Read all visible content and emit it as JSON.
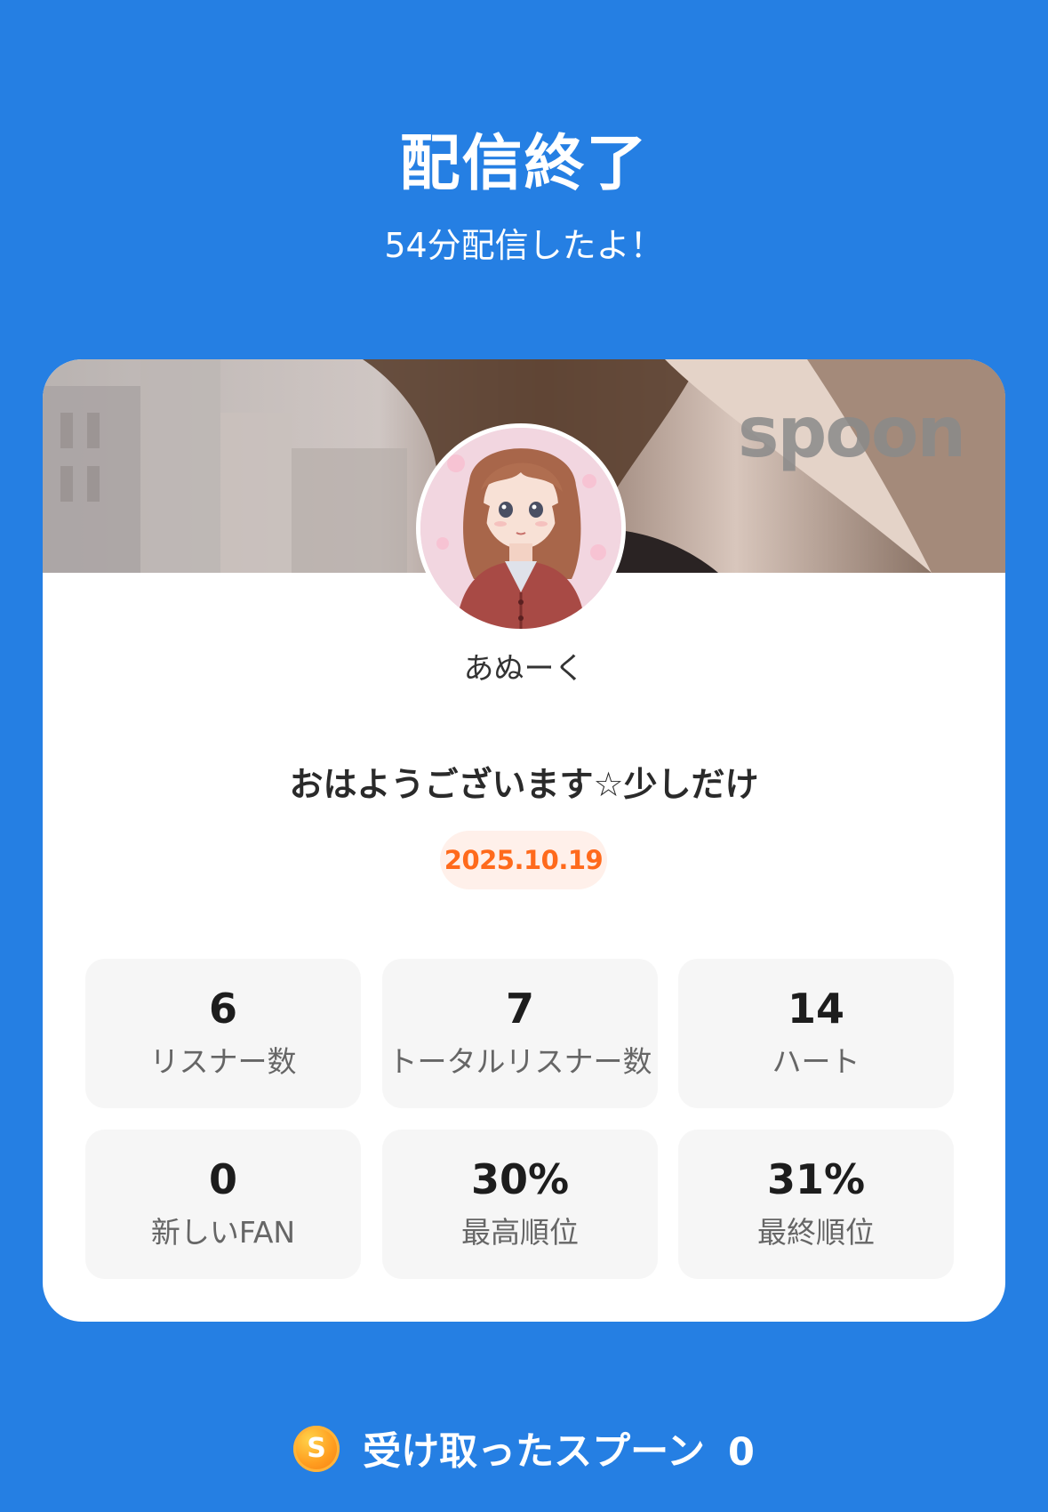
{
  "header": {
    "title": "配信終了",
    "subtitle": "54分配信したよ！"
  },
  "card": {
    "watermark": "spoon",
    "username": "あぬーく",
    "broadcast_title": "おはようございます☆少しだけ",
    "date": "2025.10.19",
    "stats": [
      {
        "value": "6",
        "label": "リスナー数"
      },
      {
        "value": "7",
        "label": "トータルリスナー数"
      },
      {
        "value": "14",
        "label": "ハート"
      },
      {
        "value": "0",
        "label": "新しいFAN"
      },
      {
        "value": "30%",
        "label": "最高順位"
      },
      {
        "value": "31%",
        "label": "最終順位"
      }
    ]
  },
  "footer": {
    "coin_letter": "S",
    "label": "受け取ったスプーン",
    "count": "0"
  },
  "colors": {
    "background": "#257fe3",
    "date_accent": "#ff6a1c",
    "coin": "#ff9d1f"
  }
}
